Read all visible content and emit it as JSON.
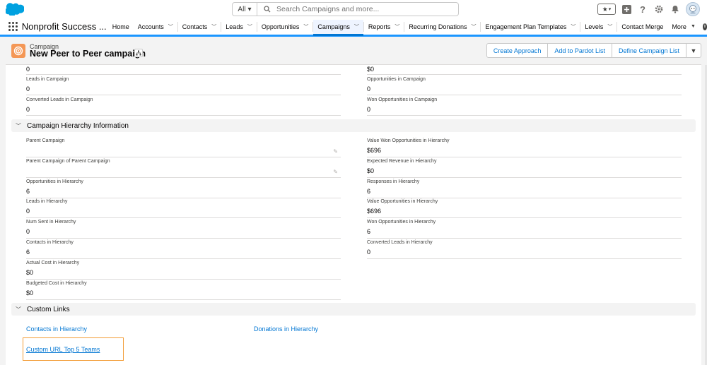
{
  "header": {
    "search_scope": "All",
    "search_placeholder": "Search Campaigns and more..."
  },
  "nav": {
    "app_name": "Nonprofit Success ...",
    "items": [
      {
        "label": "Home",
        "has_menu": false
      },
      {
        "label": "Accounts",
        "has_menu": true
      },
      {
        "label": "Contacts",
        "has_menu": true
      },
      {
        "label": "Leads",
        "has_menu": true
      },
      {
        "label": "Opportunities",
        "has_menu": true
      },
      {
        "label": "Campaigns",
        "has_menu": true,
        "active": true
      },
      {
        "label": "Reports",
        "has_menu": true
      },
      {
        "label": "Recurring Donations",
        "has_menu": true
      },
      {
        "label": "Engagement Plan Templates",
        "has_menu": true
      },
      {
        "label": "Levels",
        "has_menu": true
      },
      {
        "label": "Contact Merge",
        "has_menu": false
      },
      {
        "label": "More",
        "has_menu": true
      }
    ]
  },
  "record": {
    "type": "Campaign",
    "title": "New Peer to Peer campaign",
    "actions": [
      "Create Approach",
      "Add to Pardot List",
      "Define Campaign List"
    ]
  },
  "top_fields": {
    "left": [
      {
        "label": "",
        "value": "0"
      },
      {
        "label": "Leads in Campaign",
        "value": "0"
      },
      {
        "label": "Converted Leads in Campaign",
        "value": "0"
      }
    ],
    "right": [
      {
        "label": "",
        "value": "$0"
      },
      {
        "label": "Opportunities in Campaign",
        "value": "0"
      },
      {
        "label": "Won Opportunities in Campaign",
        "value": "0"
      }
    ]
  },
  "hierarchy": {
    "title": "Campaign Hierarchy Information",
    "left": [
      {
        "label": "Parent Campaign",
        "value": ""
      },
      {
        "label": "Parent Campaign of Parent Campaign",
        "value": ""
      },
      {
        "label": "Opportunities in Hierarchy",
        "value": "6"
      },
      {
        "label": "Leads in Hierarchy",
        "value": "0"
      },
      {
        "label": "Num Sent in Hierarchy",
        "value": "0"
      },
      {
        "label": "Contacts in Hierarchy",
        "value": "6"
      },
      {
        "label": "Actual Cost in Hierarchy",
        "value": "$0"
      },
      {
        "label": "Budgeted Cost in Hierarchy",
        "value": "$0"
      }
    ],
    "right": [
      {
        "label": "Value Won Opportunities in Hierarchy",
        "value": "$696"
      },
      {
        "label": "Expected Revenue in Hierarchy",
        "value": "$0"
      },
      {
        "label": "Responses in Hierarchy",
        "value": "6"
      },
      {
        "label": "Value Opportunities in Hierarchy",
        "value": "$696"
      },
      {
        "label": "Won Opportunities in Hierarchy",
        "value": "6"
      },
      {
        "label": "Converted Leads in Hierarchy",
        "value": "0"
      }
    ]
  },
  "custom_links": {
    "title": "Custom Links",
    "links": [
      "Contacts in Hierarchy",
      "Donations in Hierarchy",
      "Custom URL Top 5 Teams"
    ]
  },
  "colors": {
    "brand_blue": "#0176d3",
    "campaign_icon": "#f49756",
    "highlight": "#f29c35"
  }
}
